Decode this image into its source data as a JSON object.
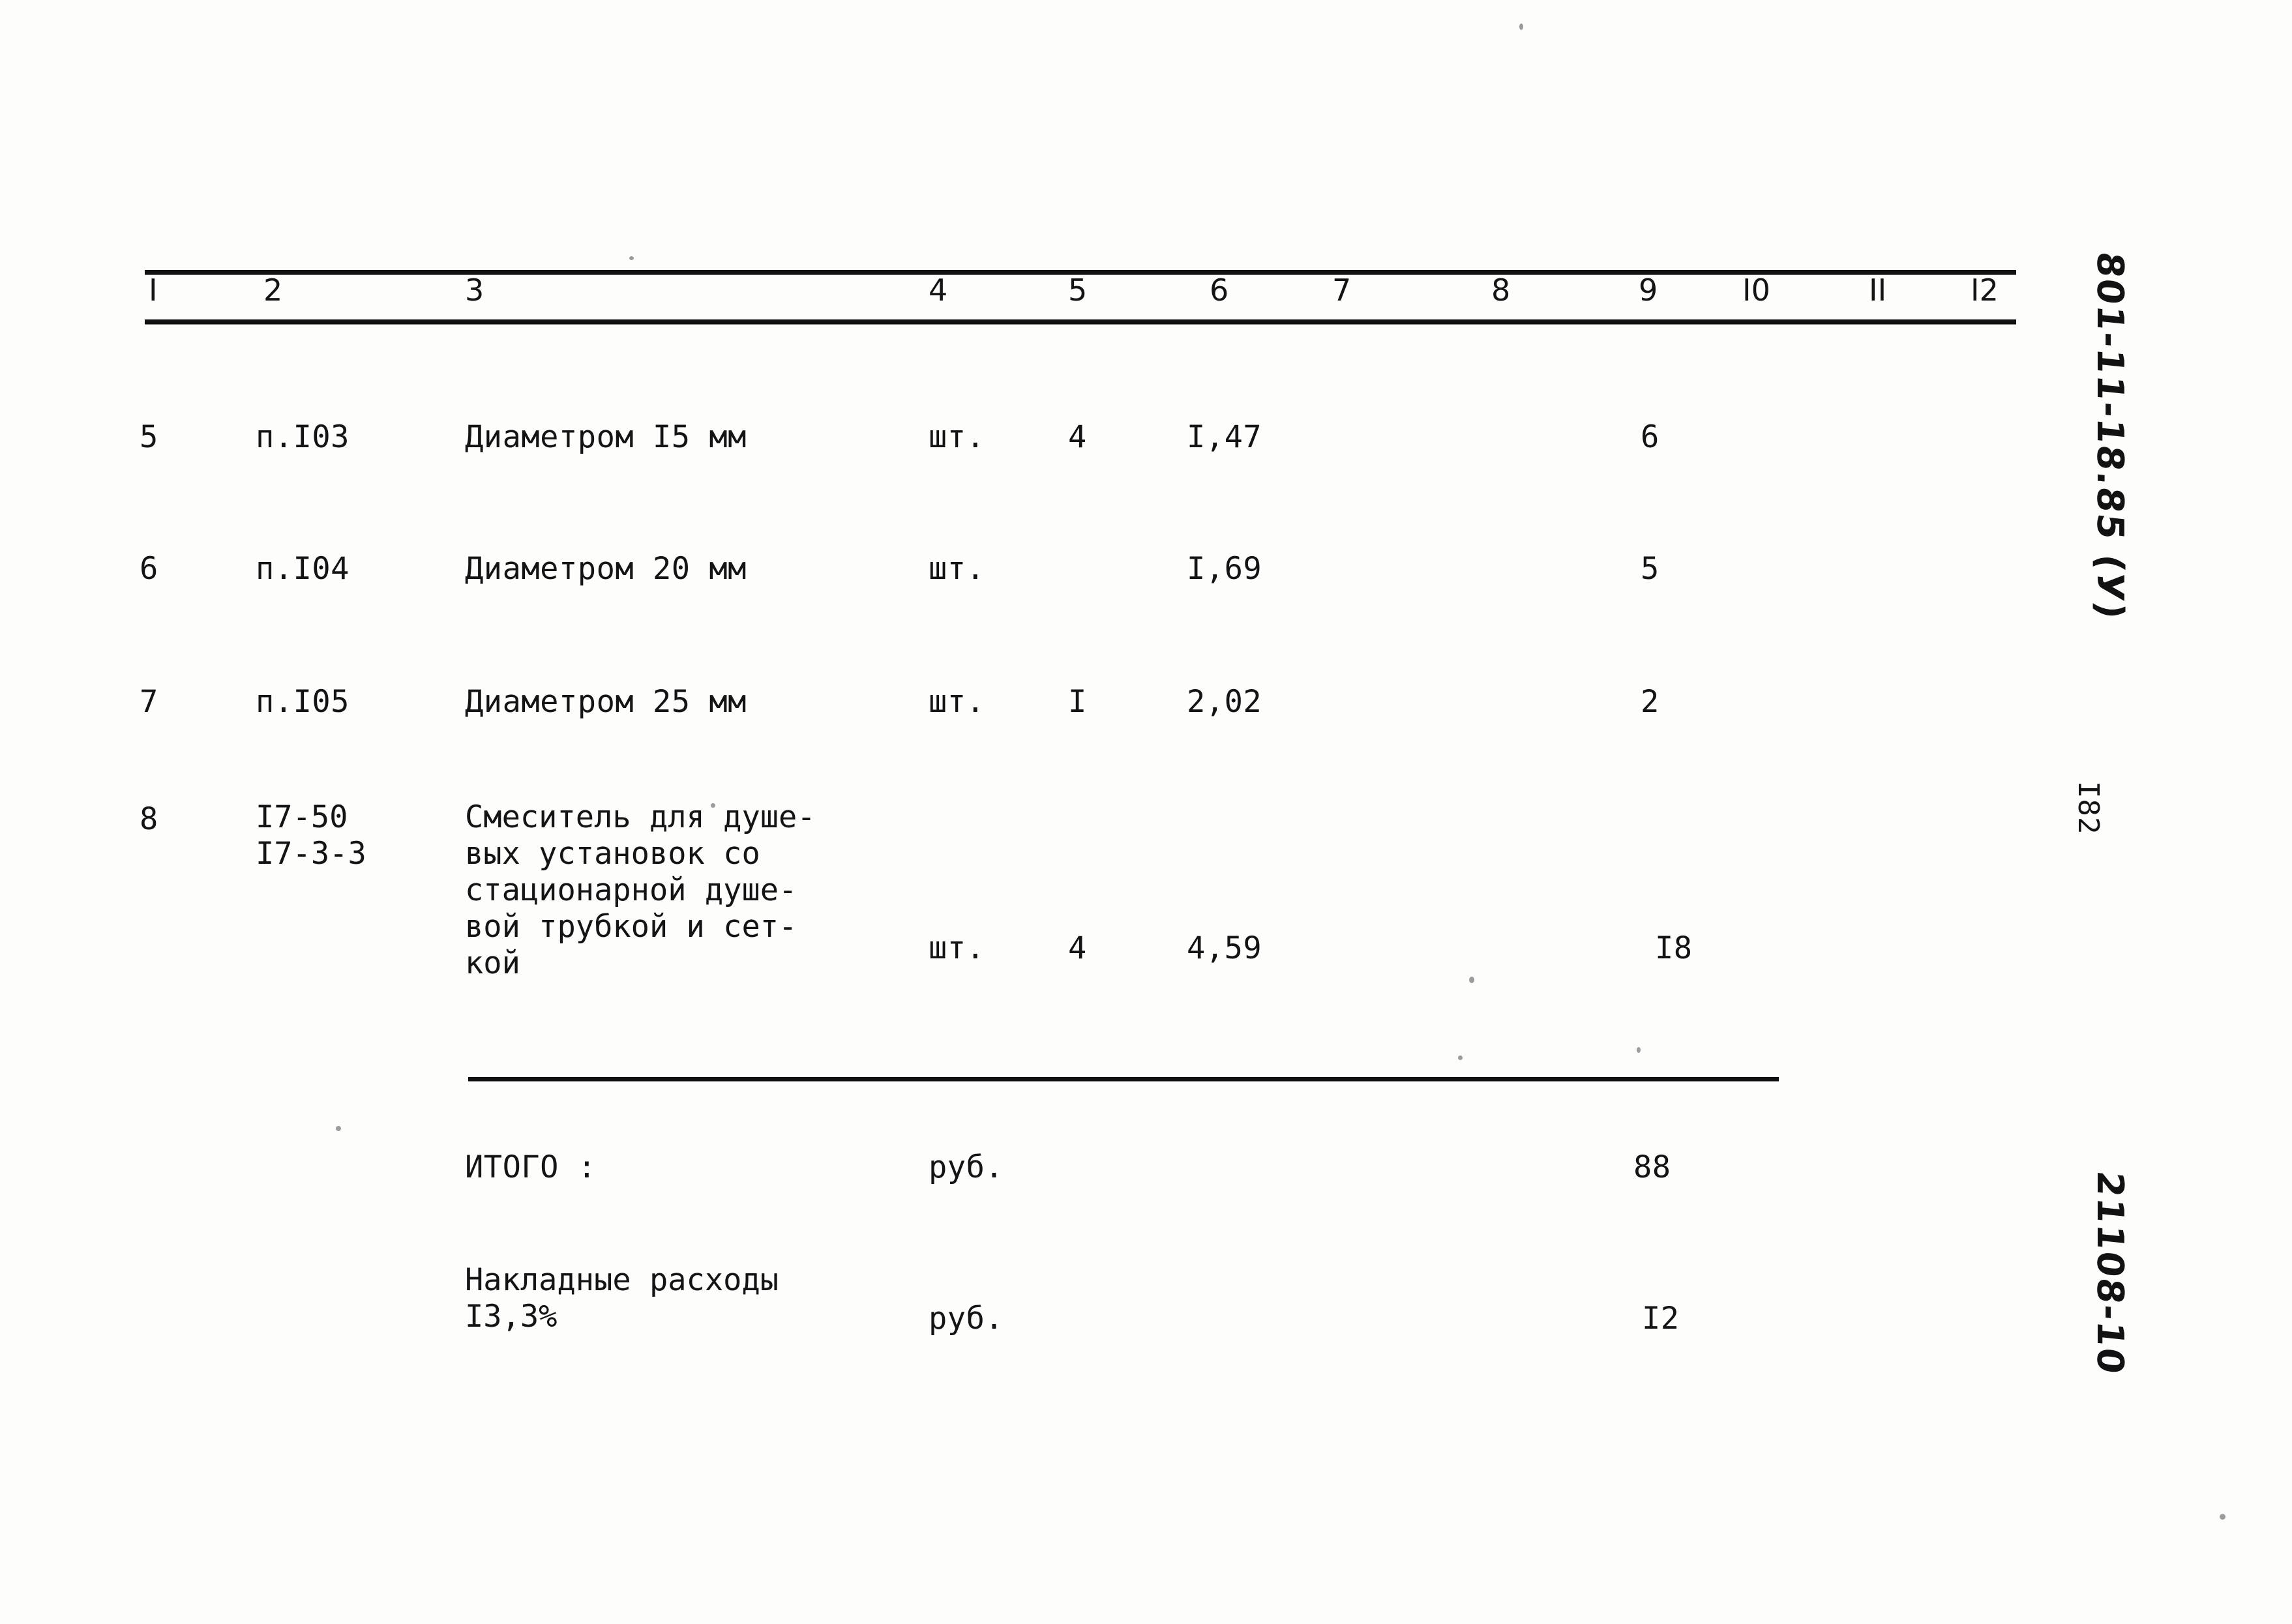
{
  "document": {
    "kind": "scanned-estimate-table",
    "page_number": "I82",
    "margin_notes": {
      "top_right_handwritten": "801-11-18.85 (У)",
      "bottom_right_handwritten": "21108-10"
    }
  },
  "table": {
    "column_headers": [
      "I",
      "2",
      "3",
      "4",
      "5",
      "6",
      "7",
      "8",
      "9",
      "I0",
      "II",
      "I2"
    ],
    "rows": [
      {
        "c1": "5",
        "c2": "п.I03",
        "c3": "Диаметром I5 мм",
        "c4": "шт.",
        "c5": "4",
        "c6": "I,47",
        "c7": "",
        "c8": "",
        "c9": "6",
        "c10": "",
        "c11": "",
        "c12": ""
      },
      {
        "c1": "6",
        "c2": "п.I04",
        "c3": "Диаметром 20 мм",
        "c4": "шт.",
        "c5": "",
        "c6": "I,69",
        "c7": "",
        "c8": "",
        "c9": "5",
        "c10": "",
        "c11": "",
        "c12": ""
      },
      {
        "c1": "7",
        "c2": "п.I05",
        "c3": "Диаметром 25 мм",
        "c4": "шт.",
        "c5": "I",
        "c6": "2,02",
        "c7": "",
        "c8": "",
        "c9": "2",
        "c10": "",
        "c11": "",
        "c12": ""
      },
      {
        "c1": "8",
        "c2": "I7-50\nI7-3-3",
        "c3": "Смеситель для душе-\nвых установок со\nстационарной душе-\nвой трубкой и сет-\nкой",
        "c4": "шт.",
        "c5": "4",
        "c6": "4,59",
        "c7": "",
        "c8": "",
        "c9": "I8",
        "c10": "",
        "c11": "",
        "c12": ""
      }
    ],
    "totals": [
      {
        "label": "ИТОГО :",
        "unit": "руб.",
        "value": "88"
      },
      {
        "label": "Накладные расходы\nI3,3%",
        "unit": "руб.",
        "value": "I2"
      }
    ]
  },
  "colors": {
    "paper": "#fdfdfc",
    "ink": "#141414",
    "rule": "#111111"
  }
}
